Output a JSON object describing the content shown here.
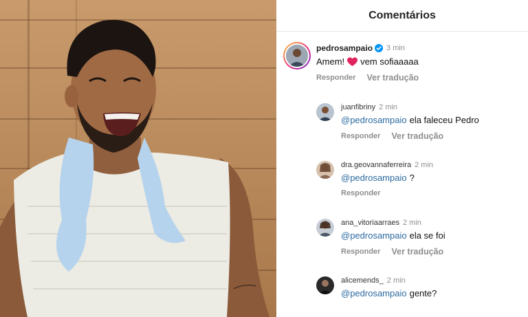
{
  "panel": {
    "title": "Comentários"
  },
  "main_comment": {
    "username": "pedrosampaio",
    "time": "3 min",
    "text_before": "Amem!",
    "text_after": "vem sofiaaaaa",
    "reply_label": "Responder",
    "translate_label": "Ver tradução"
  },
  "replies": [
    {
      "username": "juanfibriny",
      "time": "2 min",
      "mention": "@pedrosampaio",
      "text": "ela faleceu Pedro",
      "reply_label": "Responder",
      "translate_label": "Ver tradução"
    },
    {
      "username": "dra.geovannaferreira",
      "time": "2 min",
      "mention": "@pedrosampaio",
      "text": "?",
      "reply_label": "Responder"
    },
    {
      "username": "ana_vitoriaarraes",
      "time": "2 min",
      "mention": "@pedrosampaio",
      "text": "ela se foi",
      "reply_label": "Responder",
      "translate_label": "Ver tradução"
    },
    {
      "username": "alicemends_",
      "time": "2 min",
      "mention": "@pedrosampaio",
      "text": "gente?"
    }
  ],
  "colors": {
    "mention": "#2b6aa0",
    "verified": "#0095f6",
    "heart": "#e0245e",
    "muted": "#8e8e8e"
  },
  "icons": {
    "verified": "verified-badge-icon",
    "heart": "red-heart-emoji-icon"
  }
}
